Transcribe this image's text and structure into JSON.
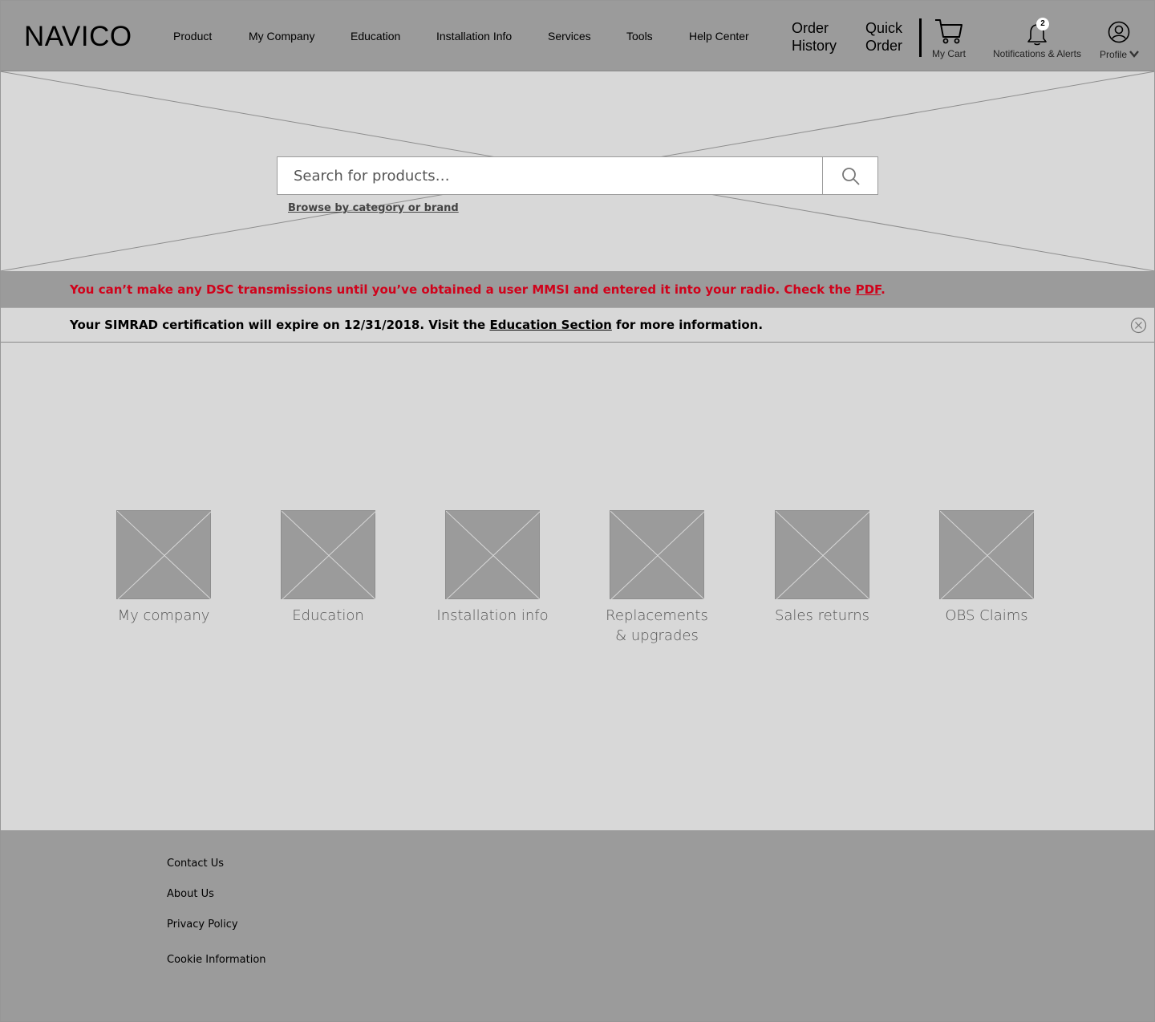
{
  "header": {
    "logo": "NAVICO",
    "nav": [
      {
        "label": "Product"
      },
      {
        "label": "My Company"
      },
      {
        "label": "Education"
      },
      {
        "label": "Installation Info"
      },
      {
        "label": "Services"
      },
      {
        "label": "Tools"
      },
      {
        "label": "Help Center"
      }
    ],
    "order_history": {
      "line1": "Order",
      "line2": "History"
    },
    "quick_order": {
      "line1": "Quick",
      "line2": "Order"
    },
    "cart": {
      "label": "My Cart",
      "icon": "cart-icon"
    },
    "notifications": {
      "label": "Notifications & Alerts",
      "count": "2",
      "icon": "bell-icon"
    },
    "profile": {
      "label": "Profile",
      "icon": "user-icon"
    }
  },
  "hero": {
    "search": {
      "placeholder": "Search for products…",
      "value": "",
      "icon": "search-icon"
    },
    "browse_link": "Browse by category or brand"
  },
  "alerts": {
    "red": {
      "text_before": "You can’t make any DSC transmissions until you’ve obtained a user MMSI and entered it into your radio. Check the ",
      "link": "PDF",
      "text_after": ".",
      "color": "#d0021b"
    },
    "info": {
      "text_before": "Your SIMRAD certification will expire on 12/31/2018. Visit the ",
      "link": "Education Section",
      "text_after": " for more information.",
      "close_icon": "close-icon"
    }
  },
  "tiles": [
    {
      "line1": "My company",
      "line2": ""
    },
    {
      "line1": "Education",
      "line2": ""
    },
    {
      "line1": "Installation info",
      "line2": ""
    },
    {
      "line1": "Replacements",
      "line2": "& upgrades"
    },
    {
      "line1": "Sales returns",
      "line2": ""
    },
    {
      "line1": "OBS Claims",
      "line2": ""
    }
  ],
  "footer": {
    "links": [
      {
        "label": "Contact Us"
      },
      {
        "label": "About Us"
      },
      {
        "label": "Privacy Policy"
      },
      {
        "label": "Cookie Information"
      }
    ]
  }
}
